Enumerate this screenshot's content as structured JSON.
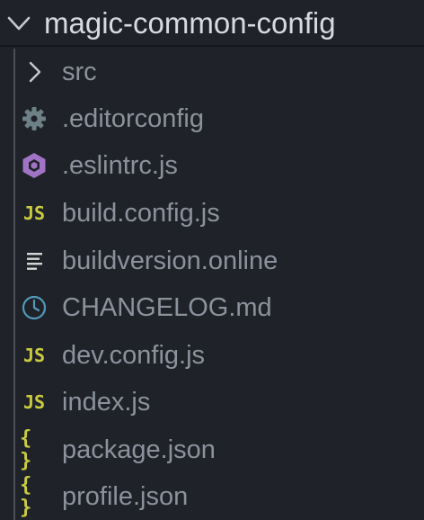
{
  "explorer": {
    "folder": {
      "title": "magic-common-config",
      "expanded": true,
      "chevron_icon": "chevron-down-icon"
    },
    "items": [
      {
        "label": "src",
        "icon": "chevron-right-icon",
        "type": "folder"
      },
      {
        "label": ".editorconfig",
        "icon": "gear-icon",
        "type": "file"
      },
      {
        "label": ".eslintrc.js",
        "icon": "eslint-icon",
        "type": "file"
      },
      {
        "label": "build.config.js",
        "icon": "javascript-icon",
        "icon_text": "JS",
        "type": "file"
      },
      {
        "label": "buildversion.online",
        "icon": "text-lines-icon",
        "type": "file"
      },
      {
        "label": "CHANGELOG.md",
        "icon": "clock-icon",
        "type": "file"
      },
      {
        "label": "dev.config.js",
        "icon": "javascript-icon",
        "icon_text": "JS",
        "type": "file"
      },
      {
        "label": "index.js",
        "icon": "javascript-icon",
        "icon_text": "JS",
        "type": "file"
      },
      {
        "label": "package.json",
        "icon": "json-icon",
        "icon_text": "{ }",
        "type": "file"
      },
      {
        "label": "profile.json",
        "icon": "json-icon",
        "icon_text": "{ }",
        "type": "file"
      }
    ]
  },
  "colors": {
    "background": "#1f2228",
    "folder_title": "#d7dae0",
    "item_label": "#8c929d",
    "gear_icon": "#6d8086",
    "eslint_icon": "#a074c4",
    "js_icon": "#cbcb41",
    "json_icon": "#cbcb41",
    "clock_icon": "#519aba",
    "lines_icon": "#d4d7d6"
  }
}
